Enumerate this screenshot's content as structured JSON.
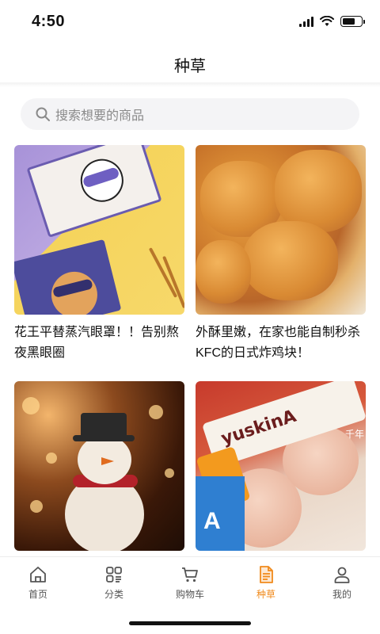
{
  "status_bar": {
    "time": "4:50"
  },
  "header": {
    "title": "种草"
  },
  "search": {
    "placeholder": "搜索想要的商品"
  },
  "feed": [
    {
      "title": "花王平替蒸汽眼罩！！告别熬夜黑眼圈",
      "image": "eye-mask-boxes"
    },
    {
      "title": "外酥里嫩，在家也能自制秒杀KFC的日式炸鸡块！",
      "image": "fried-chicken"
    },
    {
      "title": "",
      "image": "snowman-figurine"
    },
    {
      "title": "",
      "image": "yuskin-cream-feet",
      "brand_text": "yuskinA",
      "pack_text": "A",
      "corner_text": "千年"
    }
  ],
  "tab_bar": {
    "active": "种草",
    "accent_color": "#f08a1c",
    "items": [
      {
        "label": "首页",
        "icon": "home-icon"
      },
      {
        "label": "分类",
        "icon": "category-icon"
      },
      {
        "label": "购物车",
        "icon": "cart-icon"
      },
      {
        "label": "种草",
        "icon": "note-icon"
      },
      {
        "label": "我的",
        "icon": "user-icon"
      }
    ]
  }
}
